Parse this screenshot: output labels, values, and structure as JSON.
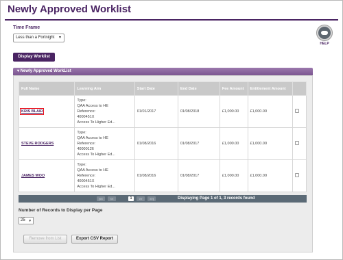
{
  "page": {
    "title": "Newly Approved Worklist"
  },
  "filters": {
    "time_frame_label": "Time Frame",
    "time_frame_value": "Less than a Fortnight"
  },
  "help": {
    "label": "HELP",
    "icon": "help-icon"
  },
  "actions": {
    "display_worklist": "Display Worklist"
  },
  "panel": {
    "title": "Newly Approved WorkList"
  },
  "table": {
    "columns": [
      "Full Name",
      "Learning Aim",
      "Start Date",
      "End Date",
      "Fee Amount",
      "Entitlement Amount",
      ""
    ],
    "rows": [
      {
        "name": "KRIS BLAIR",
        "aim": [
          "Type:",
          "QAA Access to HE",
          "Reference:",
          "4000451X",
          "Access To Higher Ed..."
        ],
        "start": "01/01/2017",
        "end": "01/08/2018",
        "fee": "£1,000.00",
        "entitlement": "£1,000.00"
      },
      {
        "name": "STEVE RODGERS",
        "aim": [
          "Type:",
          "QAA Access to HE",
          "Reference:",
          "40000126",
          "Access To Higher Ed..."
        ],
        "start": "01/08/2016",
        "end": "01/08/2017",
        "fee": "£1,000.00",
        "entitlement": "£1,000.00"
      },
      {
        "name": "JAMES WOO",
        "aim": [
          "Type:",
          "QAA Access to HE",
          "Reference:",
          "4000451X",
          "Access To Higher Ed..."
        ],
        "start": "01/08/2016",
        "end": "01/08/2017",
        "fee": "£1,000.00",
        "entitlement": "£1,000.00"
      }
    ]
  },
  "pager": {
    "first": "|<<",
    "prev": "<<",
    "current_page": "1",
    "next": ">>",
    "last": ">>|",
    "info": "Displaying Page 1 of 1, 3 records found"
  },
  "records": {
    "label": "Number of Records to Display per Page",
    "value": "25"
  },
  "buttons": {
    "remove": "Remove from List",
    "export": "Export CSV Report"
  }
}
